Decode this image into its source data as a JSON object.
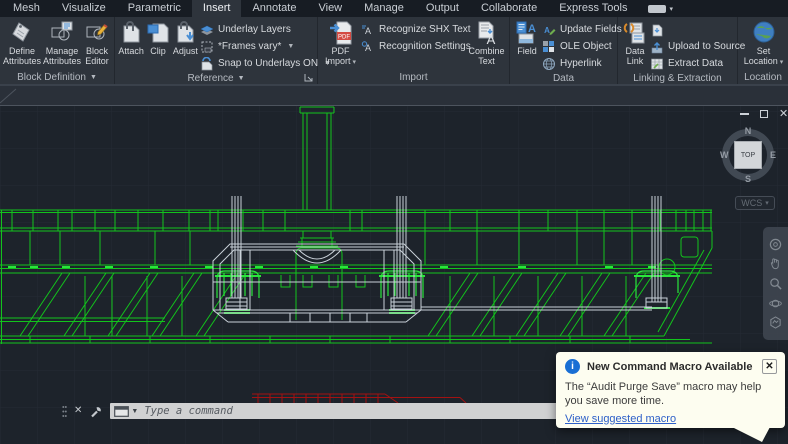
{
  "ribbon": {
    "tabs": [
      {
        "label": "Mesh"
      },
      {
        "label": "Visualize"
      },
      {
        "label": "Parametric"
      },
      {
        "label": "Insert"
      },
      {
        "label": "Annotate"
      },
      {
        "label": "View"
      },
      {
        "label": "Manage"
      },
      {
        "label": "Output"
      },
      {
        "label": "Collaborate"
      },
      {
        "label": "Express Tools"
      }
    ],
    "active_tab": "Insert",
    "panels": {
      "block_definition": {
        "title": "Block Definition",
        "define_attributes": {
          "line1": "Define",
          "line2": "Attributes"
        },
        "manage_attributes": {
          "line1": "Manage",
          "line2": "Attributes"
        },
        "block_editor": {
          "line1": "Block",
          "line2": "Editor"
        }
      },
      "reference": {
        "title": "Reference",
        "attach": "Attach",
        "clip": "Clip",
        "adjust": "Adjust",
        "rows": [
          {
            "label": "Underlay Layers"
          },
          {
            "label": "*Frames vary*"
          },
          {
            "label": "Snap to Underlays ON"
          }
        ]
      },
      "import": {
        "title": "Import",
        "pdf_import": {
          "line1": "PDF",
          "line2": "Import"
        },
        "rows": [
          {
            "label": "Recognize SHX Text"
          },
          {
            "label": "Recognition Settings"
          }
        ],
        "combine_text": {
          "line1": "Combine",
          "line2": "Text"
        }
      },
      "data": {
        "title": "Data",
        "field": "Field",
        "rows": [
          {
            "label": "Update Fields"
          },
          {
            "label": "OLE Object"
          },
          {
            "label": "Hyperlink"
          }
        ]
      },
      "linking": {
        "title": "Linking & Extraction",
        "data_link": {
          "line1": "Data",
          "line2": "Link"
        },
        "rows": [
          {
            "label": "Upload to Source"
          },
          {
            "label": "Extract Data"
          }
        ]
      },
      "location": {
        "title": "Location",
        "set_location": {
          "line1": "Set",
          "line2": "Location"
        }
      }
    }
  },
  "canvas": {
    "viewcube": {
      "north": "N",
      "south": "S",
      "east": "E",
      "west": "W",
      "face": "TOP"
    },
    "wcs_label": "WCS"
  },
  "command_bar": {
    "placeholder": "Type a command"
  },
  "notification": {
    "title": "New Command Macro Available",
    "body_line1": "The “Audit Purge Save” macro may help",
    "body_line2": "you save more time.",
    "link_label": "View suggested macro"
  },
  "colors": {
    "wire_green": "#12c41c",
    "wire_bright_green": "#2ae53c",
    "wire_white": "#c9d1d9",
    "wire_red": "#a31212",
    "accent_blue": "#4a8fd4"
  }
}
